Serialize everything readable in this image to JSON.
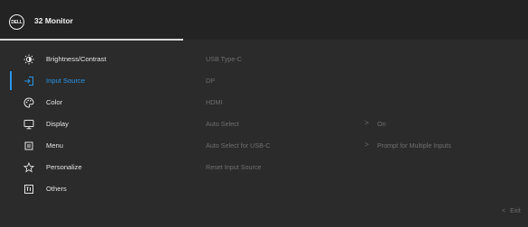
{
  "header": {
    "logo_text": "DELL",
    "title": "32 Monitor"
  },
  "sidebar": {
    "items": [
      {
        "label": "Brightness/Contrast",
        "icon": "brightness-icon"
      },
      {
        "label": "Input Source",
        "icon": "input-source-icon",
        "active": true
      },
      {
        "label": "Color",
        "icon": "color-palette-icon"
      },
      {
        "label": "Display",
        "icon": "display-icon"
      },
      {
        "label": "Menu",
        "icon": "menu-icon"
      },
      {
        "label": "Personalize",
        "icon": "star-icon"
      },
      {
        "label": "Others",
        "icon": "others-icon"
      }
    ]
  },
  "main": {
    "options": [
      {
        "label": "USB Type-C"
      },
      {
        "label": "DP"
      },
      {
        "label": "HDMI"
      },
      {
        "label": "Auto Select",
        "chevron": ">",
        "value": "On"
      },
      {
        "label": "Auto Select for USB-C",
        "chevron": ">",
        "value": "Prompt for Multiple Inputs"
      },
      {
        "label": "Reset Input Source"
      }
    ]
  },
  "footer": {
    "exit_chevron": "<",
    "exit_label": "Exit"
  },
  "colors": {
    "accent": "#2a95e6",
    "background": "#2b2b2b",
    "header": "#232323",
    "dim_text": "#6f6f6f"
  }
}
